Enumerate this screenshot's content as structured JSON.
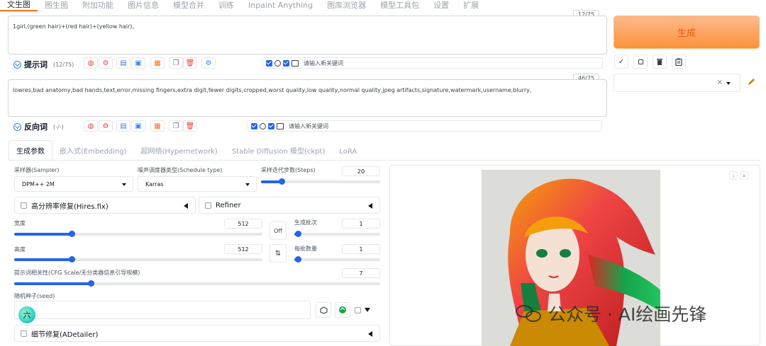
{
  "nav": {
    "tabs": [
      "文生图",
      "图生图",
      "附加功能",
      "图片信息",
      "模型合并",
      "训练",
      "Inpaint Anything",
      "图库浏览器",
      "模型工具包",
      "设置",
      "扩展"
    ],
    "active": 0
  },
  "prompt": {
    "text": "1girl,(green hair)+(red hair)+(yellow hair),",
    "counter": "12/75",
    "label": "提示词",
    "count": "(12/75)",
    "kw_placeholder": "请输入新关键词"
  },
  "negative": {
    "text": "lowres,bad anatomy,bad hands,text,error,missing fingers,extra digit,fewer digits,cropped,worst quality,low quality,normal quality,jpeg artifacts,signature,watermark,username,blurry,",
    "counter": "46/75",
    "label": "反向词",
    "count": "(-/-)",
    "kw_placeholder": "请输入新关键词"
  },
  "generate": {
    "label": "生成"
  },
  "right_tools": {
    "check_icon": "✓",
    "square_icon": "☐",
    "trash_icon": "trash",
    "clipboard_icon": "clipboard",
    "style_clear": "×",
    "pencil_icon": "pencil"
  },
  "subtabs": [
    "生成参数",
    "嵌入式(Embedding)",
    "超网络(Hypernetwork)",
    "Stable Diffusion 模型(ckpt)",
    "LoRA"
  ],
  "params": {
    "sampler_label": "采样器(Sampler)",
    "sampler_value": "DPM++ 2M",
    "schedule_label": "噪声调度器类型(Schedule type)",
    "schedule_value": "Karras",
    "steps_label": "采样迭代步数(Steps)",
    "steps_value": "20",
    "steps_frac": 0.17,
    "hires_label": "高分辨率修复(Hires.fix)",
    "refiner_label": "Refiner",
    "width_label": "宽度",
    "width_value": "512",
    "width_frac": 0.23,
    "height_label": "高度",
    "height_value": "512",
    "height_frac": 0.23,
    "off_label": "Off",
    "swap_icon": "⇅",
    "batch_count_label": "生成批次",
    "batch_count_value": "1",
    "batch_count_frac": 0.04,
    "batch_size_label": "每批数量",
    "batch_size_value": "1",
    "batch_size_frac": 0.04,
    "cfg_label": "提示词相关性(CFG Scale/无分类器信息引导规模)",
    "cfg_value": "7",
    "cfg_frac": 0.21,
    "seed_label": "随机种子(seed)",
    "seed_value": "",
    "avatar_text": "六",
    "adetailer_label": "细节修复(ADetailer)"
  },
  "watermark": {
    "text": "公众号 · AI绘画先锋"
  },
  "colors": {
    "accent": "#f97316",
    "blue": "#2563eb"
  }
}
